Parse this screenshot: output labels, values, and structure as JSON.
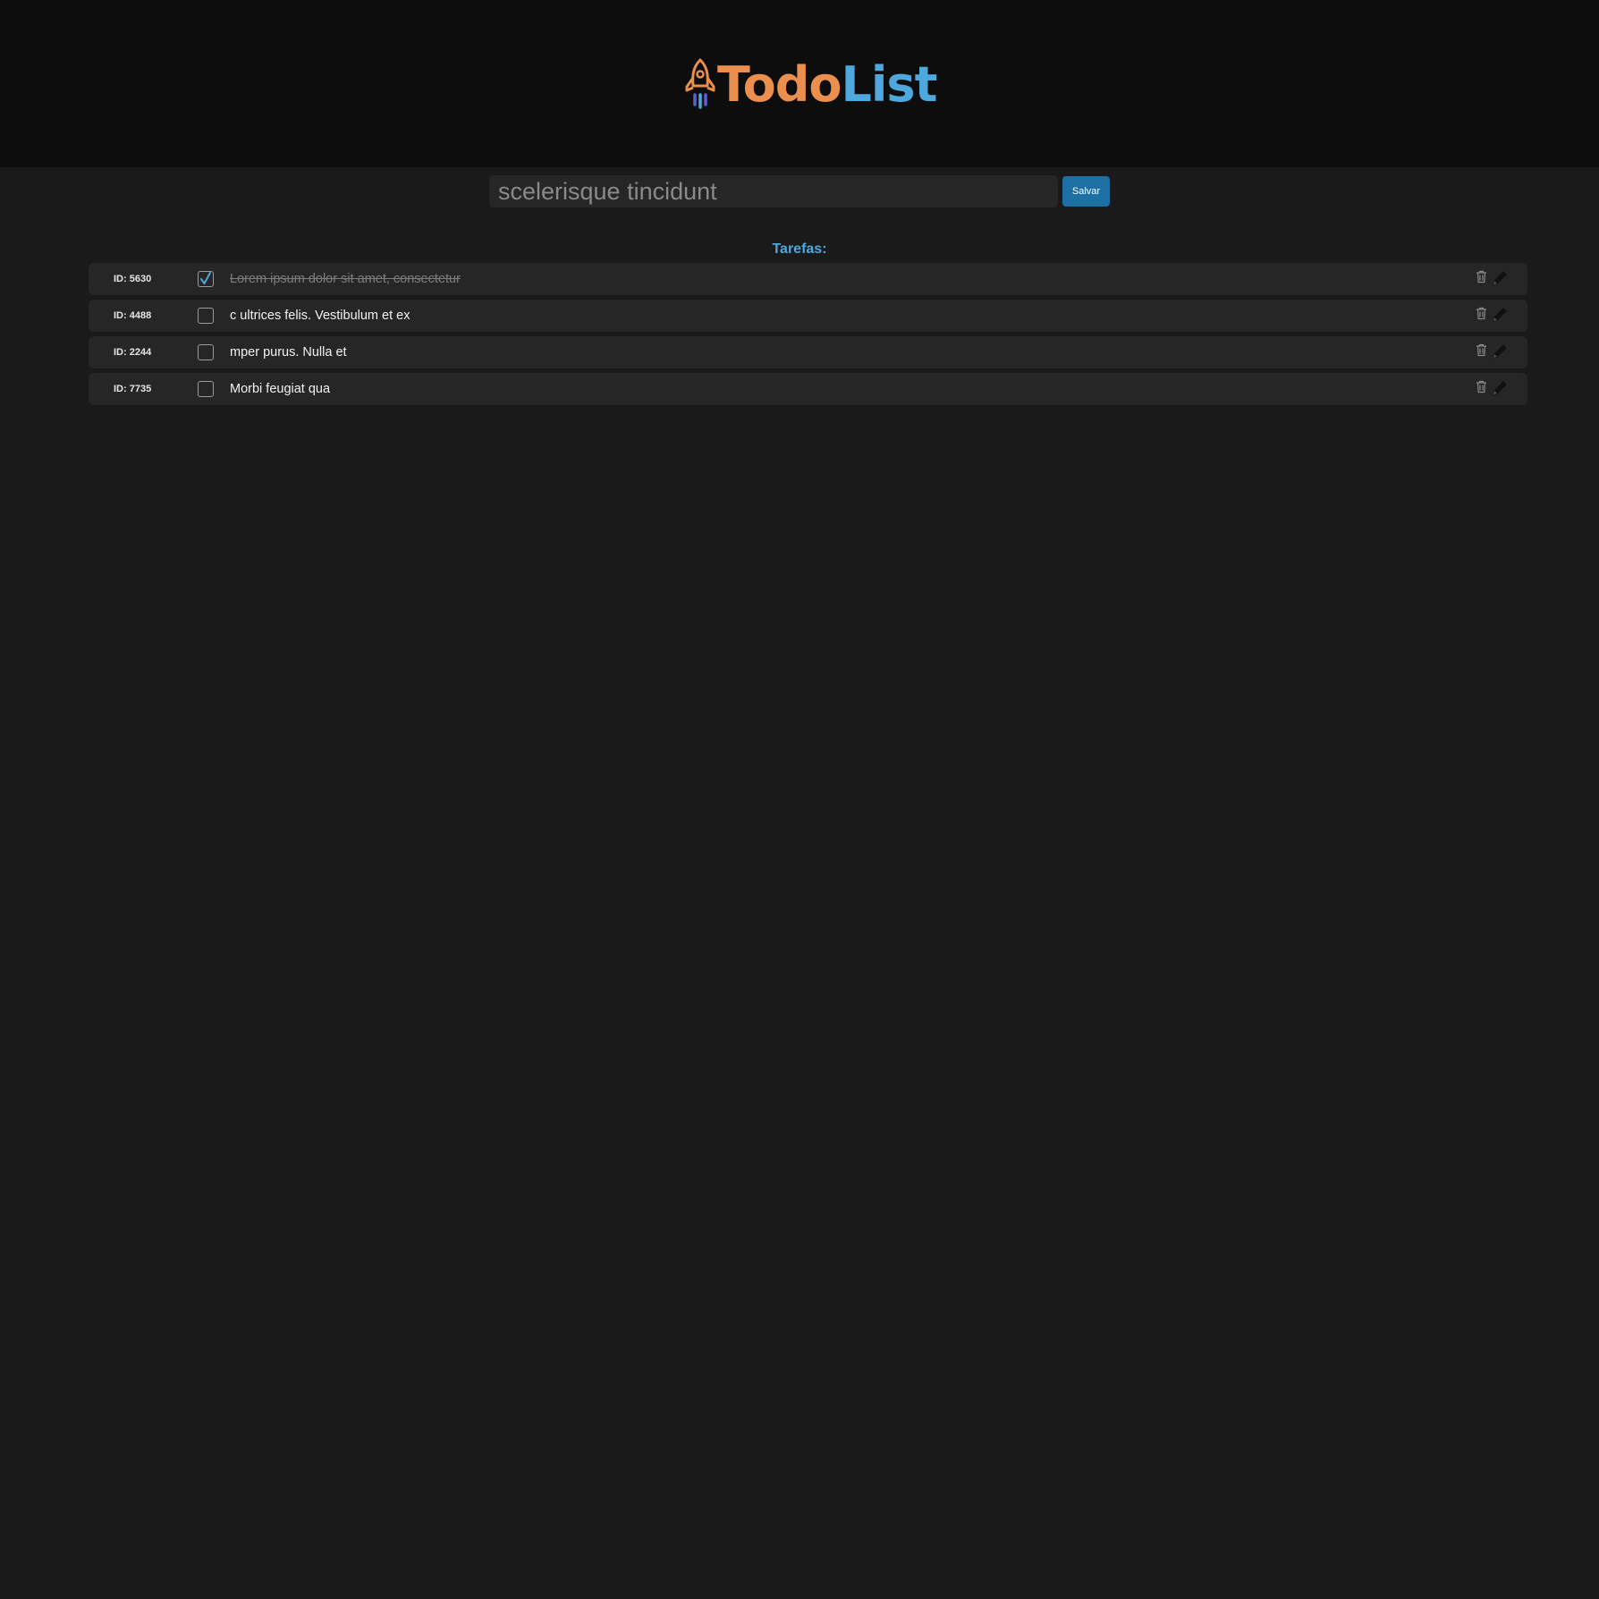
{
  "header": {
    "logo_icon": "rocket-icon",
    "logo_part1": "Todo",
    "logo_part2": "List",
    "colors": {
      "orange": "#ea8f4e",
      "blue": "#4ea8de",
      "header_bg": "#0d0d0d"
    }
  },
  "form": {
    "input_value": "scelerisque tincidunt",
    "save_label": "Salvar"
  },
  "list": {
    "title": "Tarefas:",
    "tasks": [
      {
        "id": "ID: 5630",
        "text": "Lorem ipsum dolor sit amet, consectetur",
        "done": true
      },
      {
        "id": "ID: 4488",
        "text": "c ultrices felis. Vestibulum et ex",
        "done": false
      },
      {
        "id": "ID: 2244",
        "text": "mper purus. Nulla et",
        "done": false
      },
      {
        "id": "ID: 7735",
        "text": "Morbi feugiat qua",
        "done": false
      }
    ],
    "icons": {
      "delete": "trash-icon",
      "edit": "pencil-icon"
    }
  }
}
